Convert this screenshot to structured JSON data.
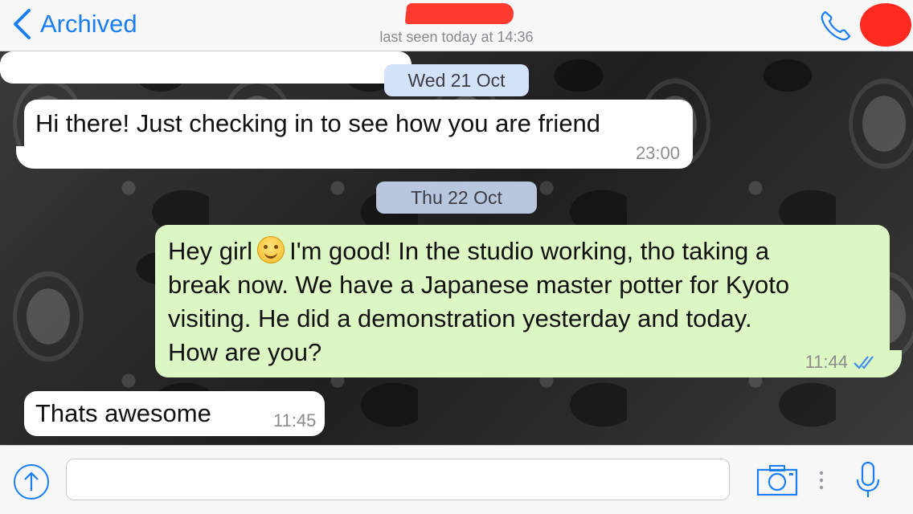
{
  "header": {
    "back_label": "Archived",
    "last_seen": "last seen today at 14:36",
    "back_icon": "chevron-left-icon",
    "call_icon": "phone-icon"
  },
  "chat": {
    "dates": [
      "Wed 21 Oct",
      "Thu 22 Oct"
    ],
    "messages": [
      {
        "direction": "incoming",
        "text": "Hi there! Just checking in to see how you are friend",
        "time": "23:00"
      },
      {
        "direction": "outgoing",
        "lines": [
          "Hey girl",
          "I'm good! In the studio working, tho taking a",
          "break now. We have a Japanese master potter for Kyoto",
          "visiting. He did a demonstration yesterday and today.",
          "How are you?"
        ],
        "emoji": "smiling-face",
        "time": "11:44",
        "status": "read"
      },
      {
        "direction": "incoming",
        "text": "Thats awesome",
        "time": "11:45"
      }
    ]
  },
  "inputbar": {
    "placeholder": "",
    "icons": [
      "share-arrow-icon",
      "camera-icon",
      "microphone-icon"
    ]
  },
  "colors": {
    "accent": "#1a7ef6",
    "outgoing_bubble": "#dcf7c4",
    "incoming_bubble": "#ffffff",
    "redaction": "#ff3b30"
  }
}
